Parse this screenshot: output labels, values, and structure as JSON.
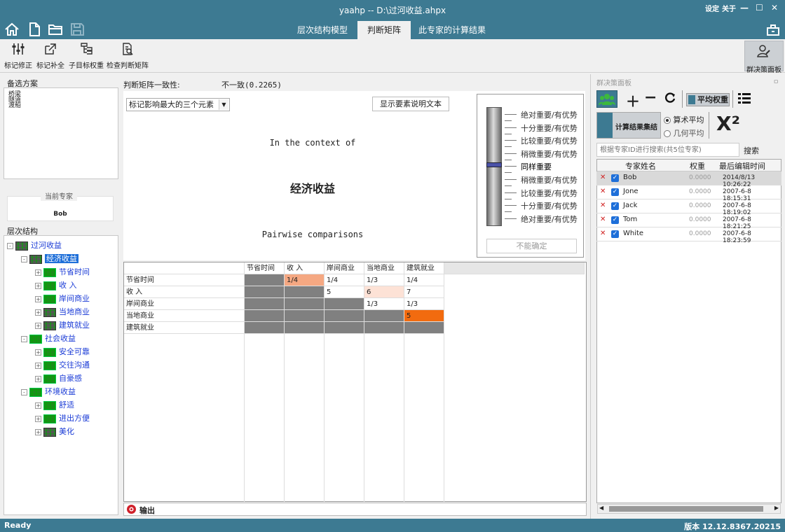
{
  "window": {
    "title": "yaahp -- D:\\过河收益.ahpx",
    "settings": "设定",
    "about": "关于",
    "minimize": "—",
    "maximize": "☐",
    "close": "✕"
  },
  "tabs": [
    {
      "label": "层次结构模型"
    },
    {
      "label": "判断矩阵",
      "active": true
    },
    {
      "label": "此专家的计算结果"
    }
  ],
  "toolbar": {
    "tools": [
      {
        "label": "标记修正"
      },
      {
        "label": "标记补全"
      },
      {
        "label": "子目标权重"
      },
      {
        "label": "检查判断矩阵"
      }
    ],
    "group_panel": "群决策面板"
  },
  "left": {
    "alternatives_title": "备选方案",
    "alternatives": [
      "桥梁",
      "隧道",
      "渡船"
    ],
    "current_expert_title": "当前专家",
    "current_expert": "Bob",
    "hierarchy_title": "层次结构",
    "tree": [
      {
        "label": "过河收益",
        "level": 0,
        "exp": "-",
        "icon": "gray"
      },
      {
        "label": "经济收益",
        "level": 1,
        "exp": "-",
        "icon": "gray",
        "selected": true
      },
      {
        "label": "节省时间",
        "level": 2,
        "exp": "+",
        "icon": "green"
      },
      {
        "label": "收 入",
        "level": 2,
        "exp": "+",
        "icon": "green"
      },
      {
        "label": "岸间商业",
        "level": 2,
        "exp": "+",
        "icon": "green"
      },
      {
        "label": "当地商业",
        "level": 2,
        "exp": "+",
        "icon": "gray"
      },
      {
        "label": "建筑就业",
        "level": 2,
        "exp": "+",
        "icon": "gray"
      },
      {
        "label": "社会收益",
        "level": 1,
        "exp": "-",
        "icon": "green"
      },
      {
        "label": "安全可靠",
        "level": 2,
        "exp": "+",
        "icon": "green"
      },
      {
        "label": "交往沟通",
        "level": 2,
        "exp": "+",
        "icon": "green"
      },
      {
        "label": "自豪感",
        "level": 2,
        "exp": "+",
        "icon": "green"
      },
      {
        "label": "环境收益",
        "level": 1,
        "exp": "-",
        "icon": "green"
      },
      {
        "label": "舒适",
        "level": 2,
        "exp": "+",
        "icon": "green"
      },
      {
        "label": "进出方便",
        "level": 2,
        "exp": "+",
        "icon": "green"
      },
      {
        "label": "美化",
        "level": 2,
        "exp": "+",
        "icon": "gray"
      }
    ]
  },
  "center": {
    "consistency_label": "判断矩阵一致性:",
    "consistency_value": "不一致(0.2265)",
    "dropdown_value": "标记影响最大的三个元素",
    "show_desc_button": "显示要素说明文本",
    "context_text": "In the context of",
    "node_title": "经济收益",
    "pairwise_text": "Pairwise comparisons",
    "scale": [
      "绝对重要/有优势",
      "十分重要/有优势",
      "比较重要/有优势",
      "稍微重要/有优势",
      "同样重要",
      "稍微重要/有优势",
      "比较重要/有优势",
      "十分重要/有优势",
      "绝对重要/有优势"
    ],
    "scale_selected_index": 4,
    "uncertain_button": "不能确定",
    "matrix": {
      "headers": [
        "节省时间",
        "收 入",
        "岸间商业",
        "当地商业",
        "建筑就业"
      ],
      "rows": [
        {
          "label": "节省时间",
          "cells": [
            "",
            "1/4",
            "1/4",
            "1/3",
            "1/4"
          ]
        },
        {
          "label": "收 入",
          "cells": [
            "",
            "",
            "5",
            "6",
            "7"
          ]
        },
        {
          "label": "岸间商业",
          "cells": [
            "",
            "",
            "",
            "1/3",
            "1/3"
          ]
        },
        {
          "label": "当地商业",
          "cells": [
            "",
            "",
            "",
            "",
            "5"
          ]
        },
        {
          "label": "建筑就业",
          "cells": [
            "",
            "",
            "",
            "",
            ""
          ]
        }
      ],
      "highlights": {
        "0-1": "#f5a882",
        "1-3": "#fde2d6",
        "3-4": "#f26b0f"
      }
    },
    "output_label": "输出"
  },
  "right": {
    "panel_title": "群决策面板",
    "pin": "ㅁ",
    "avg_weight_button": "平均权重",
    "aggregate_button": "计算结果集结",
    "arith_mean": "算术平均",
    "geo_mean": "几何平均",
    "chi_label": "X²",
    "search_placeholder": "根据专家ID进行搜索(共5位专家)",
    "search_button": "搜索",
    "columns": [
      "专家姓名",
      "权重",
      "最后编辑时间"
    ],
    "experts": [
      {
        "name": "Bob",
        "weight": "0.0000",
        "time": "2014/8/13 10:26:22"
      },
      {
        "name": "Jone",
        "weight": "0.0000",
        "time": "2007-6-8 18:15:31"
      },
      {
        "name": "Jack",
        "weight": "0.0000",
        "time": "2007-6-8 18:19:02"
      },
      {
        "name": "Tom",
        "weight": "0.0000",
        "time": "2007-6-8 18:21:25"
      },
      {
        "name": "White",
        "weight": "0.0000",
        "time": "2007-6-8 18:23:59"
      }
    ]
  },
  "status": {
    "left": "Ready",
    "right": "版本 12.12.8367.20215"
  },
  "colors": {
    "brand": "#3d7a92",
    "selection": "#1e6fd9",
    "dark_cell": "#808080"
  }
}
